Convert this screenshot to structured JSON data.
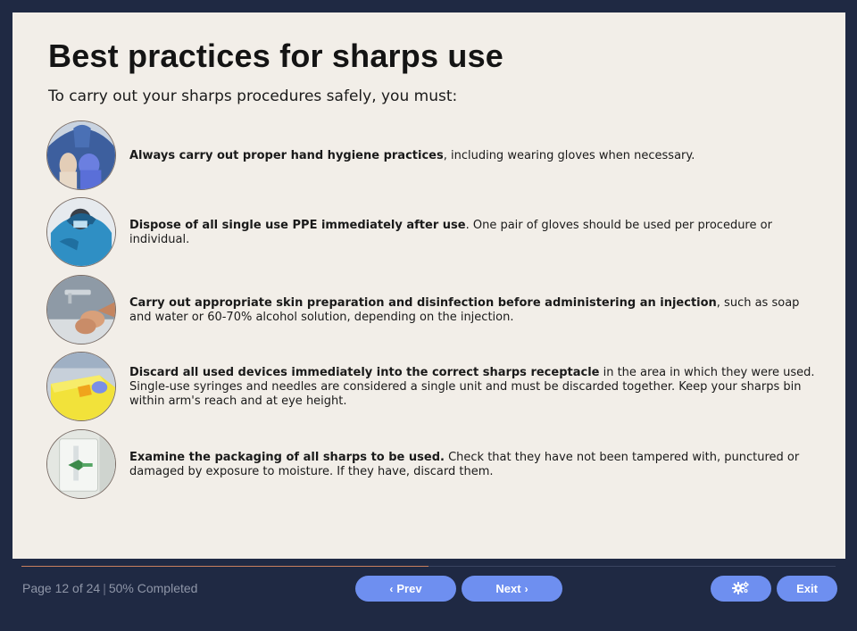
{
  "slide": {
    "title": "Best practices for sharps use",
    "subtitle": "To carry out your sharps procedures safely, you must:",
    "items": [
      {
        "bold": "Always carry out proper hand hygiene practices",
        "rest": ", including wearing gloves when necessary.",
        "icon": "gloved-hands-photo-icon"
      },
      {
        "bold": "Dispose of all single use PPE immediately after use",
        "rest": ". One pair of gloves should be used per procedure or individual.",
        "icon": "ppe-surgeon-photo-icon"
      },
      {
        "bold": "Carry out appropriate skin preparation and disinfection before administering an injection",
        "rest": ", such as soap and water or 60-70% alcohol solution, depending on the injection.",
        "icon": "handwashing-photo-icon"
      },
      {
        "bold": "Discard all used devices immediately into the correct sharps receptacle",
        "rest": " in the area in which they were used. Single-use syringes and needles are considered a single unit and must be discarded together. Keep your sharps bin within arm's reach and at eye height.",
        "icon": "sharps-bin-photo-icon"
      },
      {
        "bold": "Examine the packaging of all sharps to be used.",
        "rest": " Check that they have not been tampered with, punctured or damaged by exposure to moisture. If they have, discard them.",
        "icon": "sharps-packaging-photo-icon"
      }
    ]
  },
  "footer": {
    "page_label": "Page 12 of 24",
    "separator": "|",
    "completed_label": "50% Completed",
    "progress_fraction": 0.5,
    "prev_label": "Prev",
    "next_label": "Next",
    "exit_label": "Exit",
    "settings_icon": "gears-icon",
    "colors": {
      "background": "#1f2943",
      "slide": "#f2eee8",
      "button": "#6e8ff0",
      "progress": "#c87f5e"
    }
  }
}
